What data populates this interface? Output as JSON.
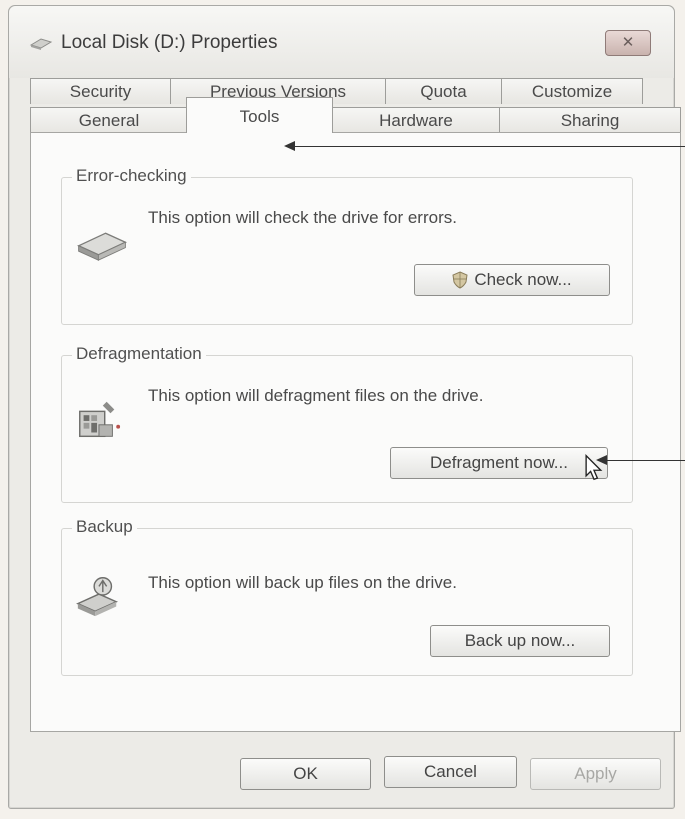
{
  "window": {
    "title": "Local Disk (D:) Properties",
    "close_label": "✕"
  },
  "tabs": {
    "row1": [
      {
        "label": "Security"
      },
      {
        "label": "Previous Versions"
      },
      {
        "label": "Quota"
      },
      {
        "label": "Customize"
      }
    ],
    "row2": [
      {
        "label": "General"
      },
      {
        "label": "Tools",
        "active": true
      },
      {
        "label": "Hardware"
      },
      {
        "label": "Sharing"
      }
    ]
  },
  "groups": {
    "error_checking": {
      "title": "Error-checking",
      "description": "This option will check the drive for errors.",
      "button": "Check now..."
    },
    "defragmentation": {
      "title": "Defragmentation",
      "description": "This option will defragment files on the drive.",
      "button": "Defragment now..."
    },
    "backup": {
      "title": "Backup",
      "description": "This option will back up files on the drive.",
      "button": "Back up now..."
    }
  },
  "footer": {
    "ok": "OK",
    "cancel": "Cancel",
    "apply": "Apply"
  },
  "icons": {
    "title": "drive-icon",
    "error_checking": "hard-drive-icon",
    "defragmentation": "defrag-icon",
    "backup": "backup-icon",
    "check_button": "shield-icon"
  }
}
